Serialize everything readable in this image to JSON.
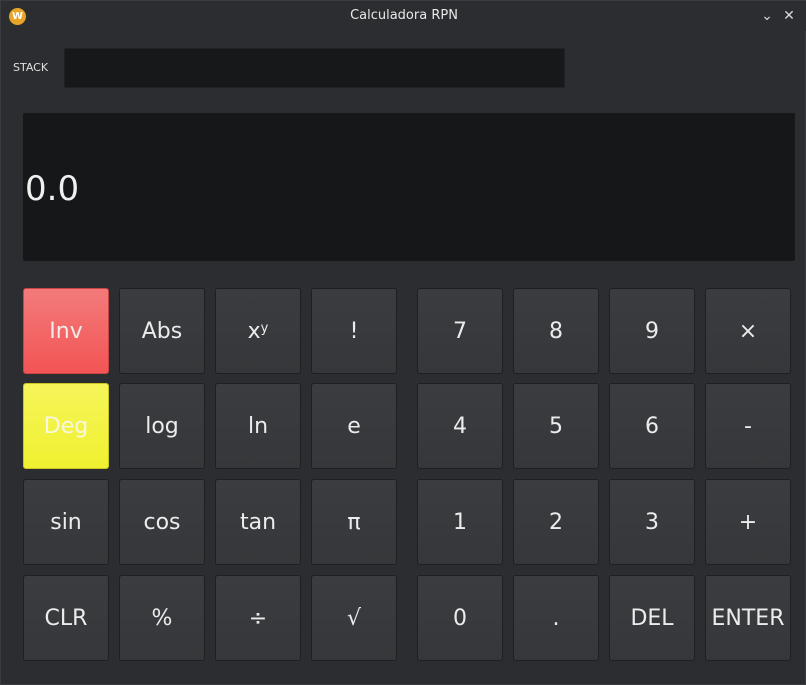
{
  "window": {
    "title": "Calculadora RPN",
    "icon": "W"
  },
  "stack": {
    "label": "STACK",
    "value": ""
  },
  "display": {
    "value": "0.0"
  },
  "colors": {
    "inv": "#f35454",
    "deg": "#f0f030",
    "background": "#2b2d30"
  },
  "buttons": {
    "inv": "Inv",
    "abs": "Abs",
    "pow_base": "x",
    "pow_exp": "y",
    "fact": "!",
    "deg": "Deg",
    "log": "log",
    "ln": "ln",
    "e": "e",
    "sin": "sin",
    "cos": "cos",
    "tan": "tan",
    "pi": "π",
    "clr": "CLR",
    "percent": "%",
    "divide": "÷",
    "sqrt": "√",
    "n7": "7",
    "n8": "8",
    "n9": "9",
    "multiply": "×",
    "n4": "4",
    "n5": "5",
    "n6": "6",
    "minus": "-",
    "n1": "1",
    "n2": "2",
    "n3": "3",
    "plus": "+",
    "n0": "0",
    "dot": ".",
    "del": "DEL",
    "enter": "ENTER"
  }
}
